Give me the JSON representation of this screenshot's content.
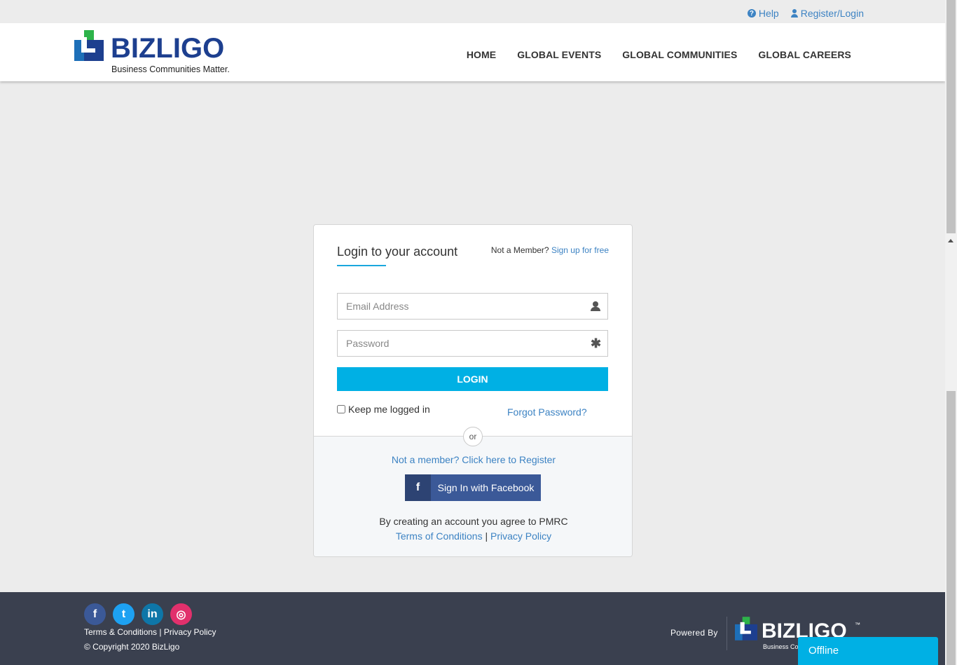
{
  "topbar": {
    "help": "Help",
    "register_login": "Register/Login"
  },
  "header": {
    "logo_text": "BIZLIGO",
    "logo_tagline": "Business Communities Matter.",
    "nav": [
      "HOME",
      "GLOBAL EVENTS",
      "GLOBAL COMMUNITIES",
      "GLOBAL CAREERS"
    ]
  },
  "login": {
    "title": "Login to your account",
    "member_prompt": "Not a Member?",
    "signup_link": "Sign up for free",
    "email_placeholder": "Email Address",
    "password_placeholder": "Password",
    "login_button": "LOGIN",
    "keep_logged_in": "Keep me logged in",
    "forgot_password": "Forgot Password?",
    "or": "or",
    "register_link": "Not a member? Click here to Register",
    "facebook_icon": "f",
    "facebook_button": "Sign In with Facebook",
    "agree_text": "By creating an account you agree to PMRC",
    "terms": "Terms of Conditions",
    "separator": "|",
    "privacy": "Privacy Policy"
  },
  "footer": {
    "social": [
      {
        "name": "facebook-icon",
        "glyph": "f"
      },
      {
        "name": "twitter-icon",
        "glyph": "t"
      },
      {
        "name": "linkedin-icon",
        "glyph": "in"
      },
      {
        "name": "instagram-icon",
        "glyph": "◎"
      }
    ],
    "terms": "Terms & Conditions",
    "separator": "|",
    "privacy": "Privacy Policy",
    "copyright": "© Copyright 2020 BizLigo",
    "powered_by": "Powered By",
    "logo_text": "BIZLIGO",
    "logo_tm": "™",
    "logo_tagline": "Business Communities Matter."
  },
  "chat": {
    "status": "Offline"
  },
  "colors": {
    "brand_blue": "#1d3f8f",
    "accent": "#00b0e4",
    "link": "#3d83c3",
    "facebook": "#3b5998",
    "footer_bg": "#3a404f"
  }
}
